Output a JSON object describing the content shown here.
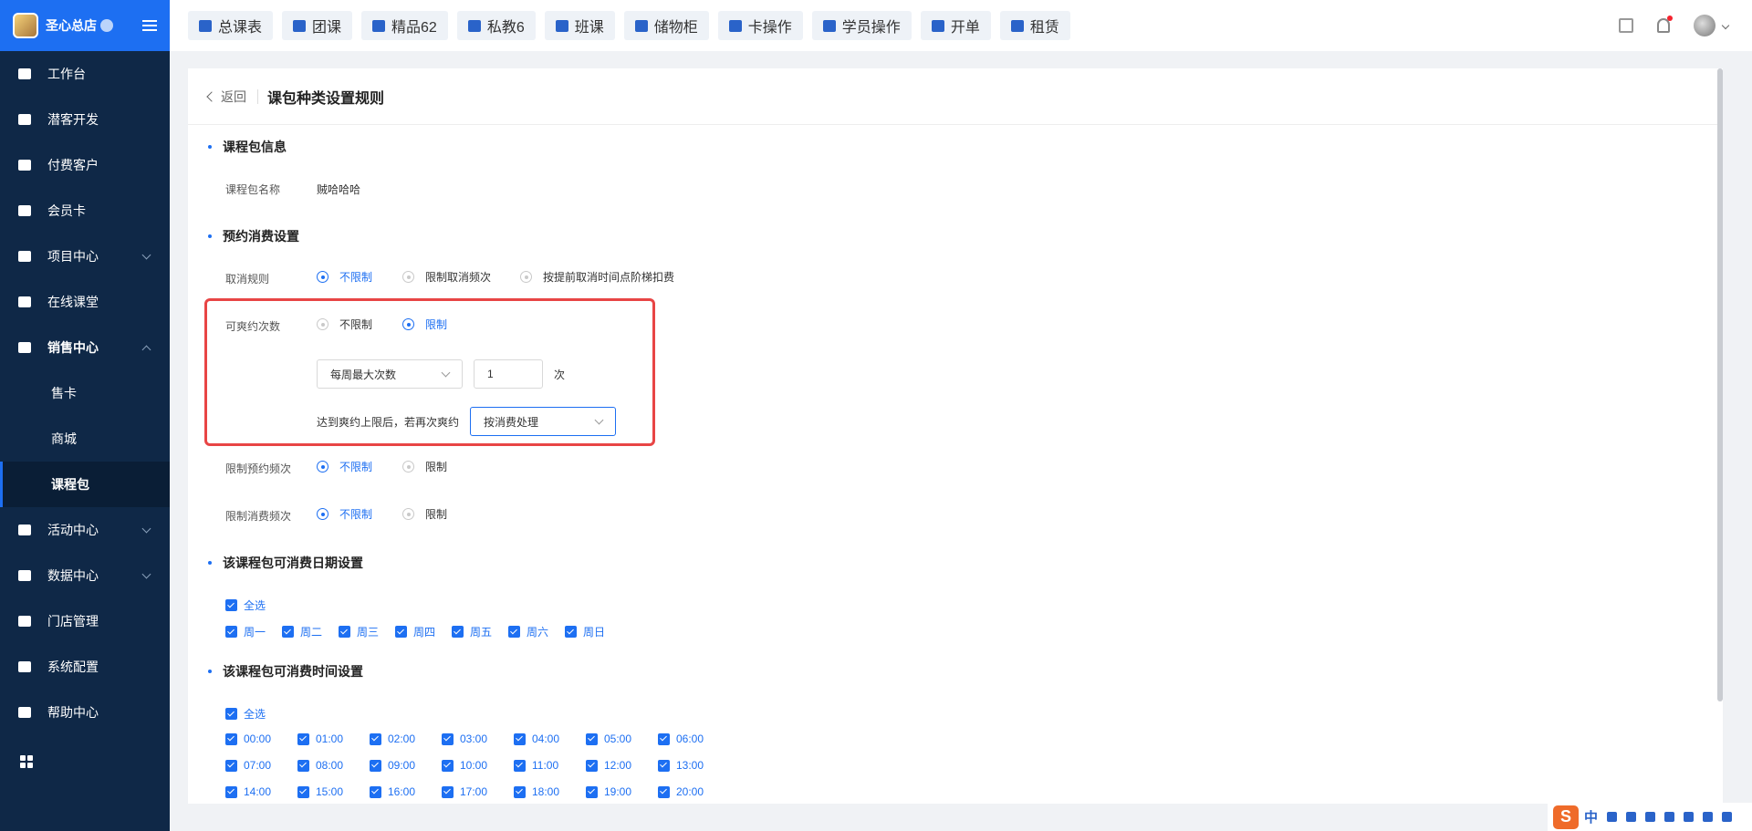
{
  "sidebar": {
    "store_name": "圣心总店",
    "items": [
      {
        "label": "工作台",
        "icon": "monitor-icon"
      },
      {
        "label": "潜客开发",
        "icon": "id-card-icon"
      },
      {
        "label": "付费客户",
        "icon": "users-icon"
      },
      {
        "label": "会员卡",
        "icon": "card-icon"
      },
      {
        "label": "项目中心",
        "icon": "project-icon"
      },
      {
        "label": "在线课堂",
        "icon": "tv-icon"
      },
      {
        "label": "销售中心",
        "icon": "tag-icon"
      },
      {
        "label": "售卡"
      },
      {
        "label": "商城"
      },
      {
        "label": "课程包"
      },
      {
        "label": "活动中心",
        "icon": "gift-icon"
      },
      {
        "label": "数据中心",
        "icon": "pie-chart-icon"
      },
      {
        "label": "门店管理",
        "icon": "store-icon"
      },
      {
        "label": "系统配置",
        "icon": "settings-icon"
      },
      {
        "label": "帮助中心",
        "icon": "help-icon"
      }
    ]
  },
  "topbar": {
    "tabs": [
      "总课表",
      "团课",
      "精品62",
      "私教6",
      "班课",
      "储物柜",
      "卡操作",
      "学员操作",
      "开单",
      "租赁"
    ]
  },
  "page": {
    "back_label": "返回",
    "title": "课包种类设置规则",
    "sec_info": "课程包信息",
    "pkg_name_label": "课程包名称",
    "pkg_name_value": "贼哈哈哈",
    "sec_booking": "预约消费设置",
    "cancel_rule_label": "取消规则",
    "cancel_opt1": "不限制",
    "cancel_opt2": "限制取消频次",
    "cancel_opt3": "按提前取消时间点阶梯扣费",
    "noshow_label": "可爽约次数",
    "noshow_opt1": "不限制",
    "noshow_opt2": "限制",
    "noshow_period": "每周最大次数",
    "noshow_count": "1",
    "noshow_unit": "次",
    "noshow_after_label": "达到爽约上限后，若再次爽约",
    "noshow_after_value": "按消费处理",
    "book_freq_label": "限制预约频次",
    "book_freq_opt1": "不限制",
    "book_freq_opt2": "限制",
    "cons_freq_label": "限制消费频次",
    "cons_freq_opt1": "不限制",
    "cons_freq_opt2": "限制",
    "sec_dates": "该课程包可消费日期设置",
    "select_all": "全选",
    "weekdays": [
      "周一",
      "周二",
      "周三",
      "周四",
      "周五",
      "周六",
      "周日"
    ],
    "sec_times": "该课程包可消费时间设置",
    "times": [
      "00:00",
      "01:00",
      "02:00",
      "03:00",
      "04:00",
      "05:00",
      "06:00",
      "07:00",
      "08:00",
      "09:00",
      "10:00",
      "11:00",
      "12:00",
      "13:00",
      "14:00",
      "15:00",
      "16:00",
      "17:00",
      "18:00",
      "19:00",
      "20:00"
    ]
  },
  "ime": {
    "logo": "S",
    "mode": "中"
  },
  "colors": {
    "accent": "#1d6ff2",
    "sidebar": "#0f2847",
    "highlight": "#e84545"
  }
}
